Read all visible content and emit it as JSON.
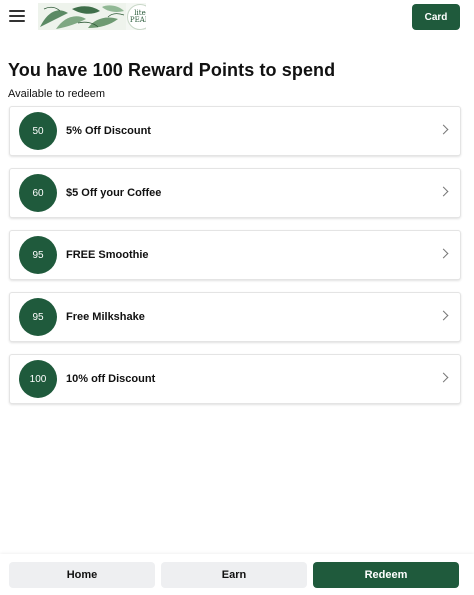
{
  "header": {
    "menu_icon": "hamburger-icon",
    "logo_badge_text": "lite PEAR",
    "card_label": "Card"
  },
  "main": {
    "title": "You have 100 Reward Points to spend",
    "subtitle": "Available to redeem",
    "rewards": [
      {
        "points": "50",
        "label": "5% Off Discount"
      },
      {
        "points": "60",
        "label": "$5 Off your Coffee"
      },
      {
        "points": "95",
        "label": "FREE Smoothie"
      },
      {
        "points": "95",
        "label": "Free Milkshake"
      },
      {
        "points": "100",
        "label": "10% off Discount"
      }
    ],
    "chevron_icon": "chevron-right-icon"
  },
  "bottom_nav": {
    "home": "Home",
    "earn": "Earn",
    "redeem": "Redeem"
  },
  "colors": {
    "brand_green": "#1f5a3c",
    "nav_inactive_bg": "#eeeff1"
  }
}
